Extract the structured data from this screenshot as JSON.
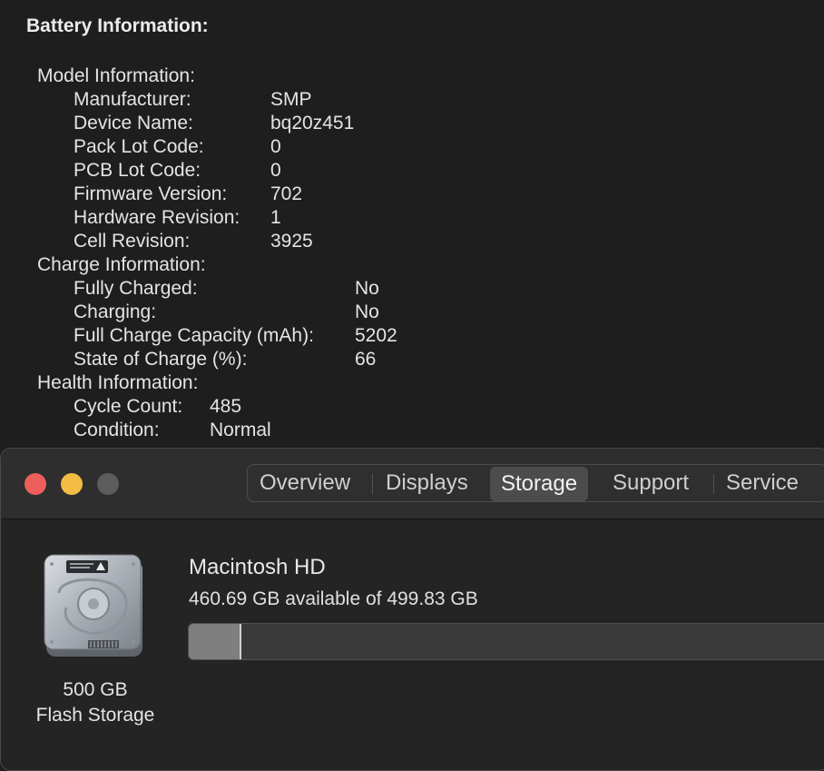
{
  "battery": {
    "heading": "Battery Information:",
    "model_title": "Model Information:",
    "model": [
      {
        "label": "Manufacturer:",
        "value": "SMP"
      },
      {
        "label": "Device Name:",
        "value": "bq20z451"
      },
      {
        "label": "Pack Lot Code:",
        "value": "0"
      },
      {
        "label": "PCB Lot Code:",
        "value": "0"
      },
      {
        "label": "Firmware Version:",
        "value": "702"
      },
      {
        "label": "Hardware Revision:",
        "value": "1"
      },
      {
        "label": "Cell Revision:",
        "value": "3925"
      }
    ],
    "charge_title": "Charge Information:",
    "charge": [
      {
        "label": "Fully Charged:",
        "value": "No"
      },
      {
        "label": "Charging:",
        "value": "No"
      },
      {
        "label": "Full Charge Capacity (mAh):",
        "value": "5202"
      },
      {
        "label": "State of Charge (%):",
        "value": "66"
      }
    ],
    "health_title": "Health Information:",
    "health": [
      {
        "label": "Cycle Count:",
        "value": "485"
      },
      {
        "label": "Condition:",
        "value": "Normal"
      }
    ]
  },
  "about": {
    "tabs": [
      "Overview",
      "Displays",
      "Storage",
      "Support",
      "Service"
    ],
    "selected_tab": "Storage",
    "storage": {
      "disk_size": "500 GB",
      "disk_kind": "Flash Storage",
      "volume_name": "Macintosh HD",
      "available_text": "460.69 GB available of 499.83 GB",
      "used_fraction": 0.078
    }
  },
  "colors": {
    "close": "#ec5f5a",
    "minimize": "#f3bc43",
    "zoom_inactive": "#5d5d5d"
  }
}
